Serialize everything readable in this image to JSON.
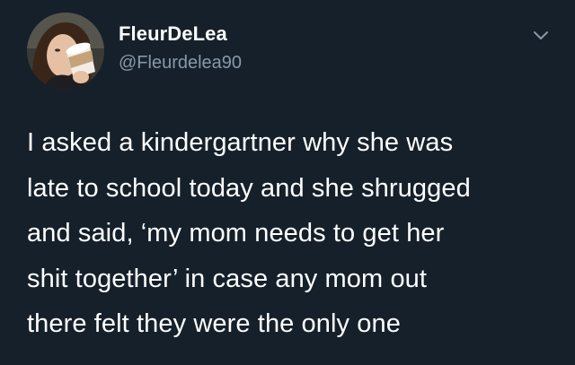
{
  "user": {
    "display_name": "FleurDeLea",
    "handle": "@Fleurdelea90"
  },
  "tweet": {
    "text": "I asked a kindergartner why she was\nlate to school today and she shrugged\nand said, ‘my mom needs to get her\nshit together’ in case any mom out\nthere felt they were the only one"
  },
  "icons": {
    "avatar": "profile-photo",
    "menu": "chevron-down-icon"
  },
  "colors": {
    "background": "#15202b",
    "primary_text": "#ffffff",
    "secondary_text": "#8899a6"
  }
}
